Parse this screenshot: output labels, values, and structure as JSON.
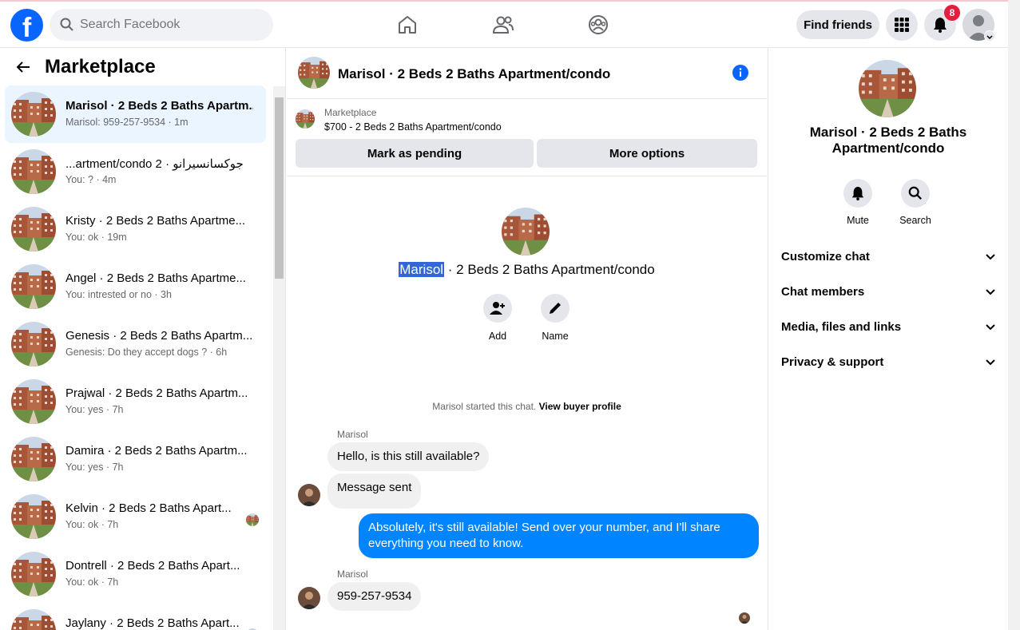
{
  "topbar": {
    "logo": "f",
    "search_placeholder": "Search Facebook",
    "find_friends": "Find friends",
    "notifications_count": "8",
    "icons": [
      "home-icon",
      "friends-icon",
      "groups-icon",
      "menu-grid-icon",
      "bell-icon"
    ]
  },
  "left": {
    "title": "Marketplace",
    "conversations": [
      {
        "name": "Marisol · 2 Beds 2 Baths Apartm...",
        "sub": "Marisol: 959-257-9534 · 1m",
        "active": true
      },
      {
        "name": "...artment/condo 2 · جوكسانسيرانو",
        "sub": "You: ? · 4m"
      },
      {
        "name": "Kristy · 2 Beds 2 Baths Apartme...",
        "sub": "You: ok · 19m"
      },
      {
        "name": "Angel · 2 Beds 2 Baths Apartme...",
        "sub": "You: intrested or no · 3h"
      },
      {
        "name": "Genesis · 2 Beds 2 Baths Apartm...",
        "sub": "Genesis: Do they accept dogs ? · 6h"
      },
      {
        "name": "Prajwal · 2 Beds 2 Baths Apartm...",
        "sub": "You: yes · 7h"
      },
      {
        "name": "Damira · 2 Beds 2 Baths Apartm...",
        "sub": "You: yes · 7h"
      },
      {
        "name": "Kelvin · 2 Beds 2 Baths Apart...",
        "sub": "You: ok · 7h"
      },
      {
        "name": "Dontrell · 2 Beds 2 Baths Apart...",
        "sub": "You: ok · 7h"
      },
      {
        "name": "Jaylany · 2 Beds 2 Baths Apart...",
        "sub": ""
      }
    ]
  },
  "chat": {
    "title": "Marisol · 2 Beds 2 Baths Apartment/condo",
    "listing_source": "Marketplace",
    "listing_price": "$700 - 2 Beds 2 Baths Apartment/condo",
    "mark_pending": "Mark as pending",
    "more_options": "More options",
    "intro_name_highlight": "Marisol",
    "intro_rest": " · 2 Beds 2 Baths Apartment/condo",
    "add_label": "Add",
    "name_label": "Name",
    "started_text": "Marisol started this chat.",
    "view_buyer": "View buyer profile",
    "sender_name": "Marisol",
    "messages": [
      {
        "text": "Hello, is this still available?"
      },
      {
        "text": "Message sent"
      },
      {
        "text": "Absolutely, it's still available! Send over your number, and I'll share everything you need to know."
      },
      {
        "text": "959-257-9534"
      }
    ]
  },
  "right": {
    "title": "Marisol · 2 Beds 2 Baths Apartment/condo",
    "mute": "Mute",
    "search": "Search",
    "sections": [
      "Customize chat",
      "Chat members",
      "Media, files and links",
      "Privacy & support"
    ]
  },
  "colors": {
    "brand": "#0866ff",
    "outgoing_bubble": "#0084ff",
    "active_row": "#ebf5ff",
    "badge": "#e41e3f"
  }
}
